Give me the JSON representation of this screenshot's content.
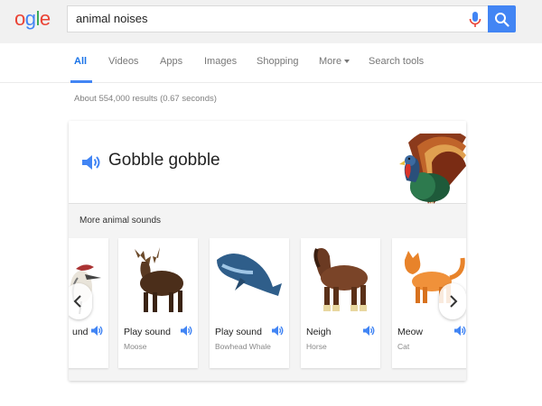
{
  "header": {
    "logo_letters": [
      "o",
      "g",
      "l",
      "e"
    ],
    "query": "animal noises"
  },
  "tabs": [
    {
      "label": "All",
      "active": true
    },
    {
      "label": "Videos"
    },
    {
      "label": "Apps"
    },
    {
      "label": "Images"
    },
    {
      "label": "Shopping"
    },
    {
      "label": "More"
    },
    {
      "label": "Search tools"
    }
  ],
  "results_count": "About 554,000 results (0.67 seconds)",
  "featured": {
    "answer": "Gobble gobble",
    "more_label": "More animal sounds"
  },
  "animals": [
    {
      "sound": "und",
      "name": ""
    },
    {
      "sound": "Play sound",
      "name": "Moose"
    },
    {
      "sound": "Play sound",
      "name": "Bowhead Whale"
    },
    {
      "sound": "Neigh",
      "name": "Horse"
    },
    {
      "sound": "Meow",
      "name": "Cat"
    }
  ],
  "colors": {
    "accent": "#4285f4",
    "tab_active": "#1a73e8",
    "logo_red": "#ea4335",
    "logo_blue": "#4285f4",
    "logo_green": "#34a853"
  },
  "icons": [
    "mic-icon",
    "search-icon",
    "speaker-icon",
    "chevron-left-icon",
    "chevron-right-icon"
  ]
}
